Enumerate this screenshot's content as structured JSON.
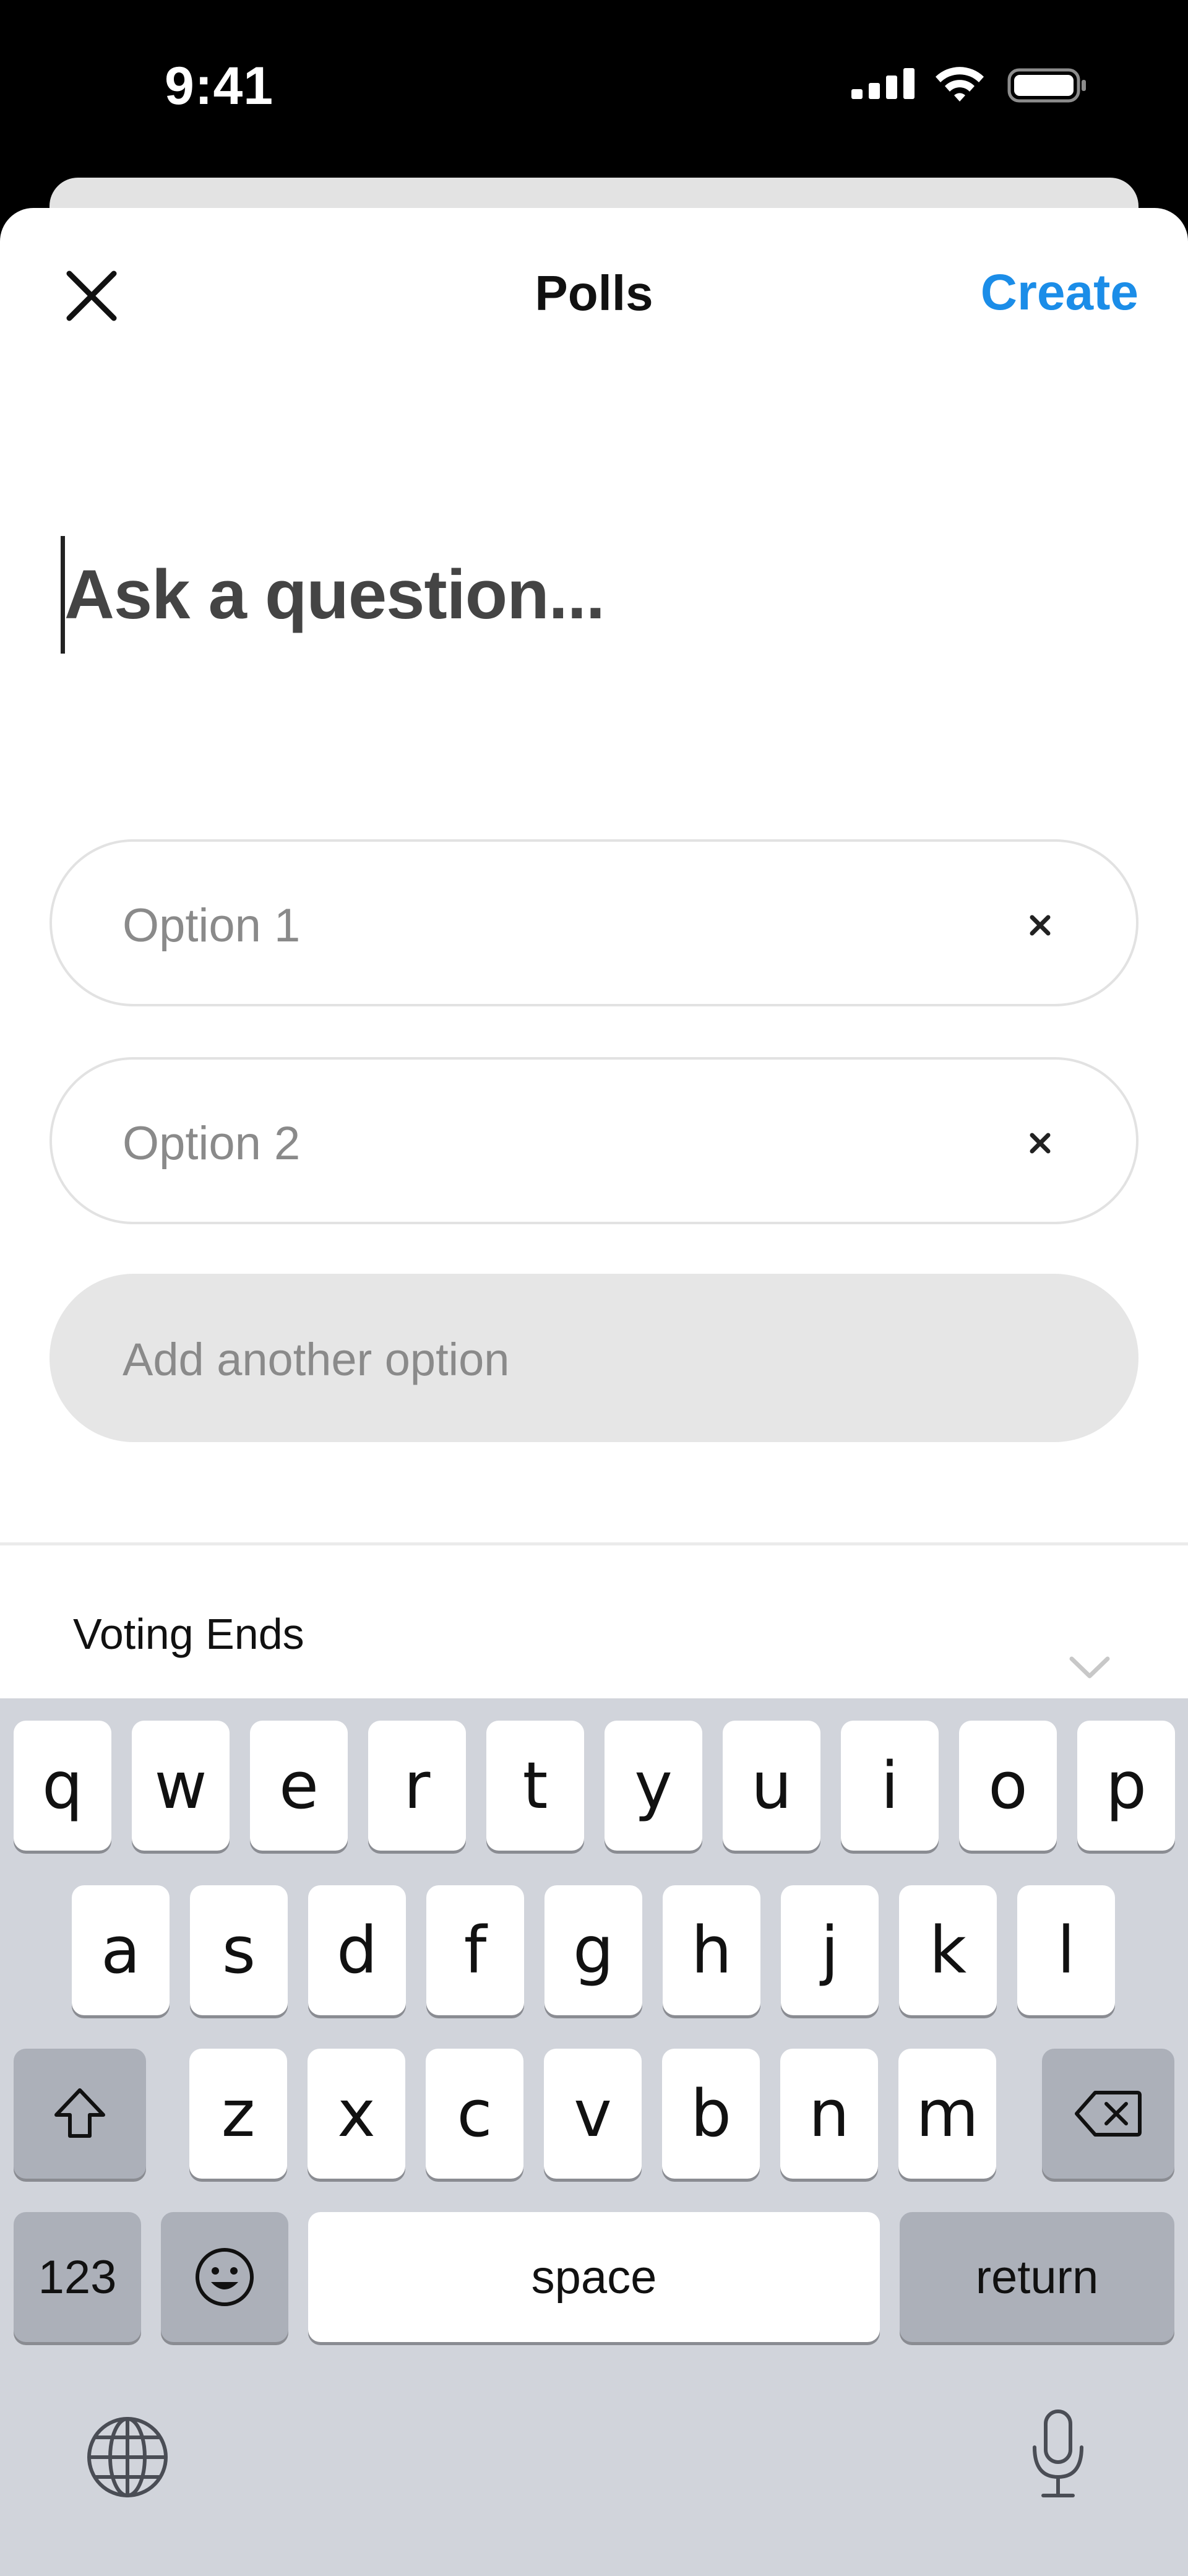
{
  "status_bar": {
    "time": "9:41"
  },
  "header": {
    "title": "Polls",
    "create_label": "Create"
  },
  "question": {
    "placeholder": "Ask a question..."
  },
  "options": [
    {
      "placeholder": "Option 1"
    },
    {
      "placeholder": "Option 2"
    }
  ],
  "add_option_label": "Add another option",
  "voting": {
    "label": "Voting Ends"
  },
  "keyboard": {
    "row1": [
      "q",
      "w",
      "e",
      "r",
      "t",
      "y",
      "u",
      "i",
      "o",
      "p"
    ],
    "row2": [
      "a",
      "s",
      "d",
      "f",
      "g",
      "h",
      "j",
      "k",
      "l"
    ],
    "row3": [
      "z",
      "x",
      "c",
      "v",
      "b",
      "n",
      "m"
    ],
    "numbers_label": "123",
    "space_label": "space",
    "return_label": "return"
  },
  "colors": {
    "accent": "#1b8de8",
    "keyboard_bg": "#d1d4db"
  },
  "icons": [
    "close-icon",
    "signal-icon",
    "wifi-icon",
    "battery-icon",
    "remove-option-icon",
    "chevron-down-icon",
    "shift-icon",
    "backspace-icon",
    "emoji-icon",
    "globe-icon",
    "microphone-icon"
  ]
}
